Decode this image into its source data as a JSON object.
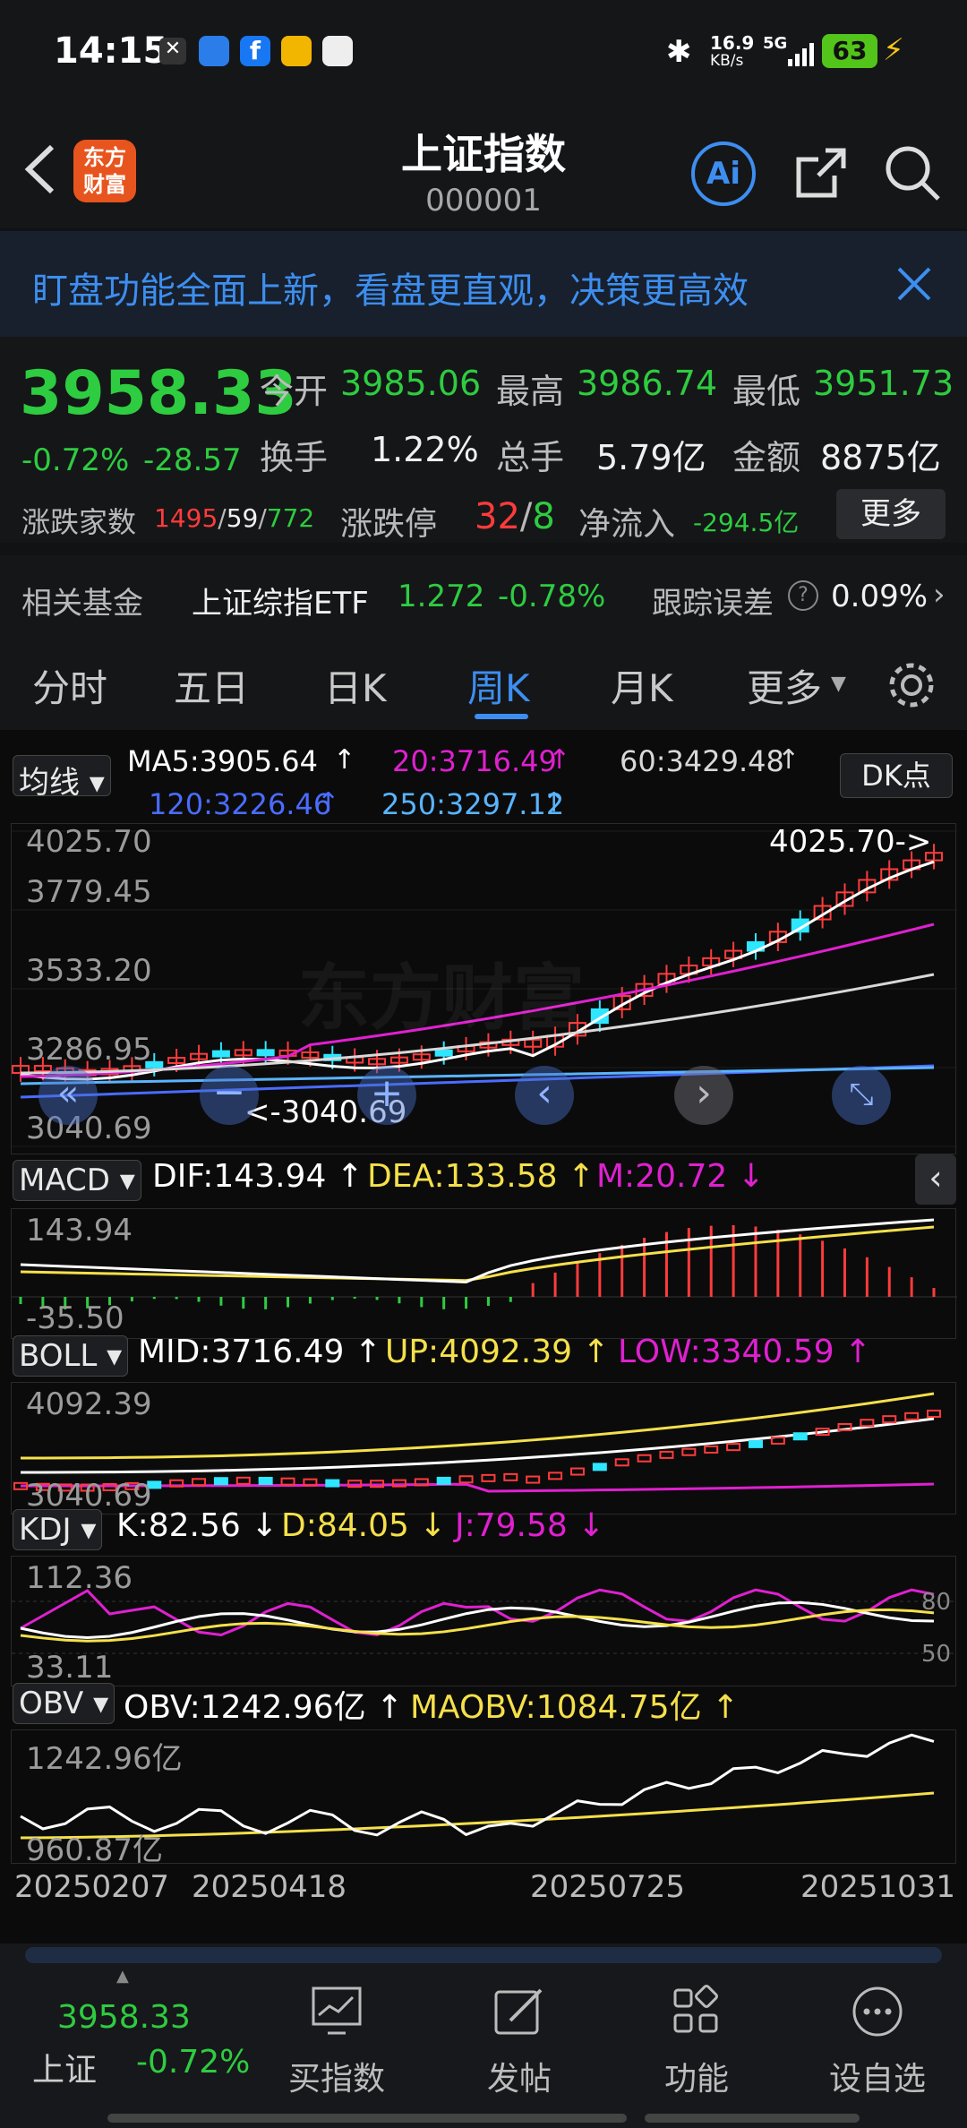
{
  "status": {
    "time": "14:15",
    "net_speed": "16.9",
    "net_unit": "KB/s",
    "network": "5G",
    "battery": "63"
  },
  "header": {
    "title": "上证指数",
    "code": "000001",
    "logo_text": "东方财富",
    "ai_label": "Ai"
  },
  "banner": {
    "text": "盯盘功能全面上新，看盘更直观，决策更高效"
  },
  "quote": {
    "price": "3958.33",
    "change_pct": "-0.72%",
    "change_amt": "-28.57",
    "open_label": "今开",
    "open": "3985.06",
    "high_label": "最高",
    "high": "3986.74",
    "low_label": "最低",
    "low": "3951.73",
    "turnover_label": "换手",
    "turnover": "1.22%",
    "volume_label": "总手",
    "volume": "5.79亿",
    "amount_label": "金额",
    "amount": "8875亿",
    "breadth_label": "涨跌家数",
    "breadth_up": "1495",
    "breadth_flat": "59",
    "breadth_down": "772",
    "limit_label": "涨跌停",
    "limit_up": "32",
    "limit_down": "8",
    "netflow_label": "净流入",
    "netflow": "-294.5亿",
    "more_btn": "更多"
  },
  "fund": {
    "label": "相关基金",
    "name": "上证综指ETF",
    "price": "1.272",
    "change": "-0.78%",
    "tracking_label": "跟踪误差",
    "tracking": "0.09%"
  },
  "tabs": [
    "分时",
    "五日",
    "日K",
    "周K",
    "月K",
    "更多"
  ],
  "active_tab": "周K",
  "kline": {
    "ma_btn": "均线",
    "ma5": "MA5:3905.64",
    "ma20": "20:3716.49",
    "ma60": "60:3429.48",
    "ma120": "120:3226.46",
    "ma250": "250:3297.12",
    "dk_btn": "DK点",
    "y_top": "4025.70",
    "y_2": "3779.45",
    "y_3": "3533.20",
    "y_4": "3286.95",
    "y_bottom": "3040.69",
    "max_marker": "4025.70->",
    "min_marker": "<-3040.69",
    "watermark": "东方财富"
  },
  "macd": {
    "btn": "MACD",
    "dif": "DIF:143.94",
    "dea": "DEA:133.58",
    "m": "M:20.72",
    "y_top": "143.94",
    "y_bottom": "-35.50"
  },
  "boll": {
    "btn": "BOLL",
    "mid": "MID:3716.49",
    "up": "UP:4092.39",
    "low": "LOW:3340.59",
    "y_top": "4092.39",
    "y_bottom": "3040.69"
  },
  "kdj": {
    "btn": "KDJ",
    "k": "K:82.56",
    "d": "D:84.05",
    "j": "J:79.58",
    "y_top": "112.36",
    "y_bottom": "33.11",
    "ref_80": "80",
    "ref_50": "50"
  },
  "obv": {
    "btn": "OBV",
    "obv": "OBV:1242.96亿",
    "maobv": "MAOBV:1084.75亿",
    "y_top": "1242.96亿",
    "y_bottom": "960.87亿"
  },
  "xaxis": [
    "20250207",
    "20250418",
    "20250725",
    "20251031"
  ],
  "bottom_nav": {
    "index_price": "3958.33",
    "index_name": "上证",
    "index_change": "-0.72%",
    "items": [
      "买指数",
      "发帖",
      "功能",
      "设自选"
    ]
  },
  "colors": {
    "up": "#ff3b3b",
    "down": "#2ecc40",
    "accent": "#3d8ef0",
    "ma5": "#ffffff",
    "ma20": "#e020d0",
    "ma60": "#d8d8d8",
    "ma120": "#4a6cff",
    "ma250": "#5ab4ff",
    "dea": "#f5e04a"
  }
}
